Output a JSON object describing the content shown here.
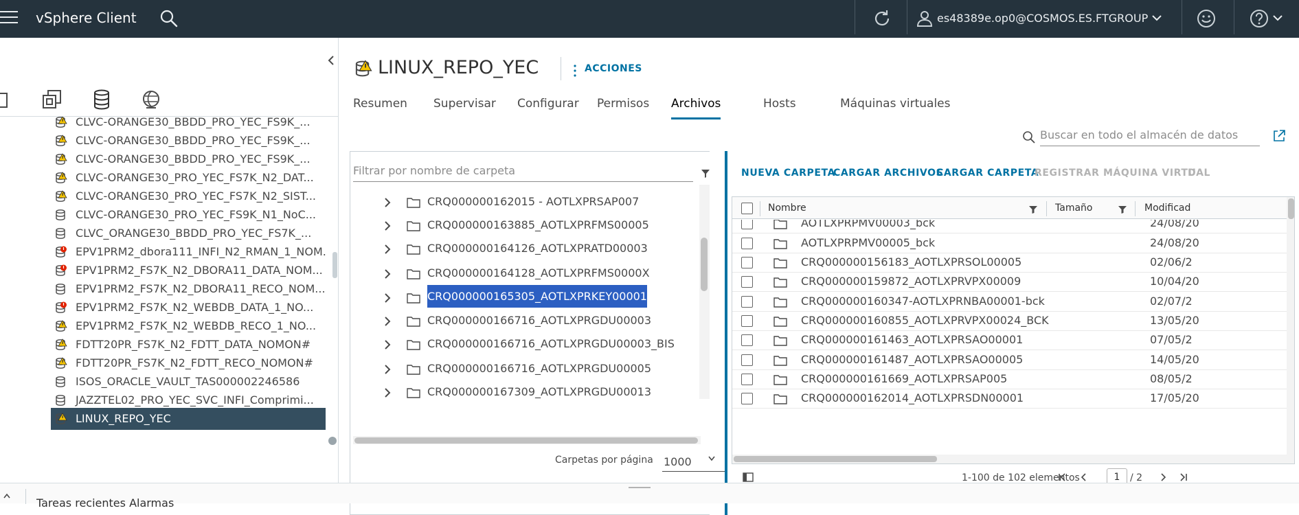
{
  "header": {
    "app_title": "vSphere Client",
    "user": "es48389e.op0@COSMOS.ES.FTGROUP",
    "icons": [
      "menu-icon",
      "search-icon",
      "refresh-icon",
      "user-icon",
      "smiley-icon",
      "help-icon"
    ]
  },
  "navigator": {
    "view_tabs": [
      "hosts-clusters-icon",
      "vms-templates-icon",
      "storage-icon",
      "networking-icon"
    ],
    "active_view": "storage-icon",
    "datastores": [
      {
        "label": "CLVC-ORANGE30_BBDD_PRO_YEC_FS9K_...",
        "status": "warning"
      },
      {
        "label": "CLVC-ORANGE30_BBDD_PRO_YEC_FS9K_...",
        "status": "warning"
      },
      {
        "label": "CLVC-ORANGE30_BBDD_PRO_YEC_FS9K_...",
        "status": "warning"
      },
      {
        "label": "CLVC-ORANGE30_PRO_YEC_FS7K_N2_DAT...",
        "status": "warning"
      },
      {
        "label": "CLVC-ORANGE30_PRO_YEC_FS7K_N2_SIST...",
        "status": "warning"
      },
      {
        "label": "CLVC-ORANGE30_PRO_YEC_FS9K_N1_NoC...",
        "status": "normal"
      },
      {
        "label": "CLVC_ORANGE30_BBDD_PRO_YEC_FS7K_...",
        "status": "normal"
      },
      {
        "label": "EPV1PRM2_dbora111_INFI_N2_RMAN_1_NOM...",
        "status": "error"
      },
      {
        "label": "EPV1PRM2_FS7K_N2_DBORA11_DATA_NOM...",
        "status": "error"
      },
      {
        "label": "EPV1PRM2_FS7K_N2_DBORA11_RECO_NOM...",
        "status": "normal"
      },
      {
        "label": "EPV1PRM2_FS7K_N2_WEBDB_DATA_1_NO...",
        "status": "error"
      },
      {
        "label": "EPV1PRM2_FS7K_N2_WEBDB_RECO_1_NO...",
        "status": "warning"
      },
      {
        "label": "FDTT20PR_FS7K_N2_FDTT_DATA_NOMON#",
        "status": "warning"
      },
      {
        "label": "FDTT20PR_FS7K_N2_FDTT_RECO_NOMON#",
        "status": "warning"
      },
      {
        "label": "ISOS_ORACLE_VAULT_TAS000002246586",
        "status": "normal"
      },
      {
        "label": "JAZZTEL02_PRO_YEC_SVC_INFI_Comprimi...",
        "status": "normal"
      },
      {
        "label": "LINUX_REPO_YEC",
        "status": "warning",
        "selected": true
      }
    ]
  },
  "object": {
    "title": "LINUX_REPO_YEC",
    "actions_label": "ACCIONES"
  },
  "tabs": [
    {
      "label": "Resumen"
    },
    {
      "label": "Supervisar"
    },
    {
      "label": "Configurar"
    },
    {
      "label": "Permisos"
    },
    {
      "label": "Archivos",
      "active": true
    },
    {
      "label": "Hosts"
    },
    {
      "label": "Máquinas virtuales"
    }
  ],
  "search": {
    "placeholder": "Buscar en todo el almacén de datos"
  },
  "folder_panel": {
    "filter_placeholder": "Filtrar por nombre de carpeta",
    "folders": [
      {
        "label": "CRQ000000162015 - AOTLXPRSAP007"
      },
      {
        "label": "CRQ000000163885_AOTLXPRFMS00005"
      },
      {
        "label": "CRQ000000164126_AOTLXPRATD00003"
      },
      {
        "label": "CRQ000000164128_AOTLXPRFMS0000X"
      },
      {
        "label": "CRQ000000165305_AOTLXPRKEY00001",
        "selected": true
      },
      {
        "label": "CRQ000000166716_AOTLXPRGDU00003"
      },
      {
        "label": "CRQ000000166716_AOTLXPRGDU00003_BIS"
      },
      {
        "label": "CRQ000000166716_AOTLXPRGDU00005"
      },
      {
        "label": "CRQ000000167309_AOTLXPRGDU00013"
      }
    ],
    "per_page_label": "Carpetas por página",
    "per_page_value": "1000"
  },
  "files_panel": {
    "actions": [
      {
        "label": "NUEVA CARPETA",
        "enabled": true
      },
      {
        "label": "CARGAR ARCHIVOS",
        "enabled": true
      },
      {
        "label": "CARGAR CARPETA",
        "enabled": true
      },
      {
        "label": "REGISTRAR MÁQUINA VIRTUAL",
        "enabled": false
      },
      {
        "label": "D",
        "enabled": false
      }
    ],
    "columns": [
      "Nombre",
      "Tamaño",
      "Modificad"
    ],
    "rows": [
      {
        "name": "AOTLXPRPMV00003_bck",
        "modified": "24/08/20"
      },
      {
        "name": "AOTLXPRPMV00005_bck",
        "modified": "24/08/20"
      },
      {
        "name": "CRQ000000156183_AOTLXPRSOL00005",
        "modified": "02/06/2"
      },
      {
        "name": "CRQ000000159872_AOTLXPRVPX00009",
        "modified": "10/04/20"
      },
      {
        "name": "CRQ000000160347-AOTLXPRNBA00001-bck",
        "modified": "02/07/2"
      },
      {
        "name": "CRQ000000160855_AOTLXPRVPX00024_BCK",
        "modified": "13/05/20"
      },
      {
        "name": "CRQ000000161463_AOTLXPRSAO00001",
        "modified": "07/05/2"
      },
      {
        "name": "CRQ000000161487_AOTLXPRSAO00005",
        "modified": "14/05/20"
      },
      {
        "name": "CRQ000000161669_AOTLXPRSAP005",
        "modified": "08/05/2"
      },
      {
        "name": "CRQ000000162014_AOTLXPRSDN00001",
        "modified": "17/05/20"
      }
    ],
    "count_text": "1-100 de 102 elementos",
    "current_page": "1",
    "total_pages": "/ 2"
  },
  "bottom_bar": {
    "label": "Tareas recientes Alarmas"
  },
  "colors": {
    "header_bg": "#25333d",
    "accent": "#0072a3",
    "selected_nav": "#344e5f",
    "selected_folder": "#2c5fc2",
    "warning": "#f5c400",
    "error": "#e12200"
  }
}
